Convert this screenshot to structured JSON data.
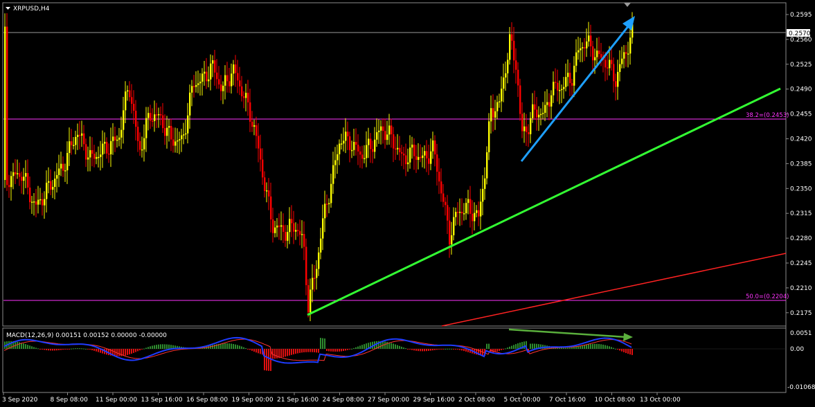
{
  "chart": {
    "symbol_label": "XRPUSD,H4",
    "last_price": "0.2570",
    "colors": {
      "background": "#000000",
      "bull_candle": "#ffff00",
      "bear_candle": "#ff0000",
      "fib_line": "#ff33ff",
      "green_trendline": "#33ff33",
      "red_trendline": "#ff2222",
      "blue_arrow": "#1ea0ff",
      "macd_line": "#1f3cff",
      "signal_line": "#ff3333",
      "hist_positive": "#2e8b2e",
      "hist_negative": "#e01010"
    },
    "fib_levels": [
      {
        "label": "38.2=(0.2453)",
        "value": 0.2453
      },
      {
        "label": "50.0=(0.2204)",
        "value": 0.2204
      }
    ],
    "price_axis": [
      "0.2595",
      "0.2560",
      "0.2525",
      "0.2490",
      "0.2455",
      "0.2420",
      "0.2385",
      "0.2350",
      "0.2315",
      "0.2280",
      "0.2245",
      "0.2210",
      "0.2175"
    ],
    "time_axis": [
      "3 Sep 2020",
      "8 Sep 08:00",
      "11 Sep 00:00",
      "13 Sep 16:00",
      "16 Sep 08:00",
      "19 Sep 00:00",
      "21 Sep 16:00",
      "24 Sep 08:00",
      "27 Sep 00:00",
      "29 Sep 16:00",
      "2 Oct 08:00",
      "5 Oct 00:00",
      "7 Oct 16:00",
      "10 Oct 08:00",
      "13 Oct 00:00"
    ]
  },
  "macd": {
    "label": "MACD(12,26,9) 0.00151 0.00152 0.00000 -0.00000",
    "axis": [
      "0.0051",
      "0.00",
      "-0.01068"
    ]
  }
}
